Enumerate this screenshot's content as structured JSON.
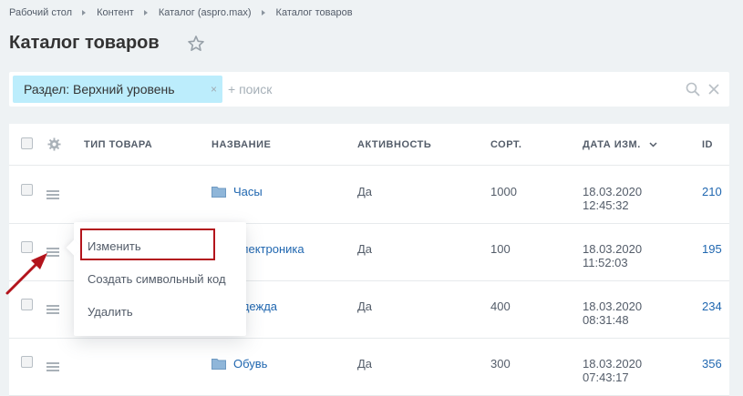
{
  "breadcrumbs": [
    "Рабочий стол",
    "Контент",
    "Каталог (aspro.max)",
    "Каталог товаров"
  ],
  "page_title": "Каталог товаров",
  "filter": {
    "tag_label": "Раздел: Верхний уровень",
    "tag_close": "×",
    "search_placeholder": "+ поиск"
  },
  "columns": {
    "type": "ТИП ТОВАРА",
    "name": "НАЗВАНИЕ",
    "active": "АКТИВНОСТЬ",
    "sort": "СОРТ.",
    "date": "ДАТА ИЗМ.",
    "id": "ID"
  },
  "rows": [
    {
      "name": "Часы",
      "active": "Да",
      "sort": "1000",
      "date": "18.03.2020",
      "time": "12:45:32",
      "id": "210"
    },
    {
      "name": "Электроника",
      "active": "Да",
      "sort": "100",
      "date": "18.03.2020",
      "time": "11:52:03",
      "id": "195"
    },
    {
      "name": "Одежда",
      "active": "Да",
      "sort": "400",
      "date": "18.03.2020",
      "time": "08:31:48",
      "id": "234"
    },
    {
      "name": "Обувь",
      "active": "Да",
      "sort": "300",
      "date": "18.03.2020",
      "time": "07:43:17",
      "id": "356"
    }
  ],
  "context_menu": {
    "items": [
      "Изменить",
      "Создать символьный код",
      "Удалить"
    ]
  },
  "icons": {
    "star": "star-icon",
    "search": "search-icon",
    "clear": "close-icon",
    "gear": "gear-icon",
    "row_menu": "hamburger-icon",
    "folder": "folder-icon",
    "sort": "chevron-down-icon",
    "annotation": "arrow-icon"
  },
  "colors": {
    "background": "#eef2f4",
    "link": "#2067b0",
    "filter_tag": "#bcedfc",
    "highlight": "#b3141c",
    "folder": "#8fb6d9"
  }
}
